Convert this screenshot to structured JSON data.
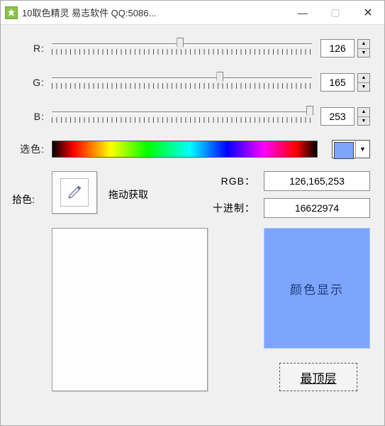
{
  "titlebar": {
    "title": "10取色精灵 易志软件 QQ:5086..."
  },
  "sliders": {
    "r": {
      "label": "R:",
      "value": "126",
      "pct": 49.4
    },
    "g": {
      "label": "G:",
      "value": "165",
      "pct": 64.7
    },
    "b": {
      "label": "B:",
      "value": "253",
      "pct": 99.2
    }
  },
  "select_label": "选色:",
  "pick_label": "拾色:",
  "drag_hint": "拖动获取",
  "rgb_label": "RGB：",
  "rgb_value": "126,165,253",
  "dec_label": "十进制：",
  "dec_value": "16622974",
  "color_display_label": "颜色显示",
  "top_button_label": "最顶层",
  "swatch_color": "#7ea5fd",
  "display_color": "#7ea5fd"
}
